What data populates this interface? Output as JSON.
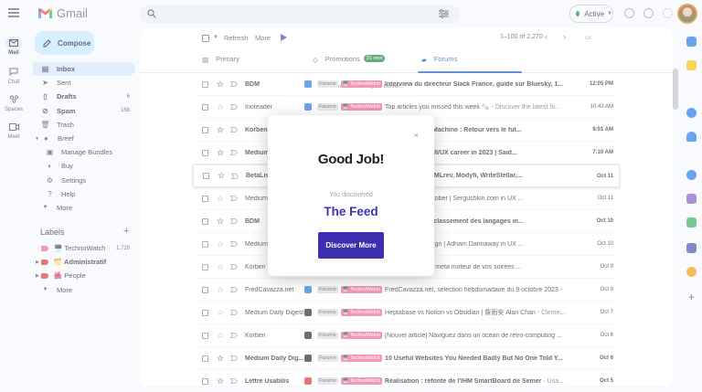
{
  "app": {
    "name": "Gmail"
  },
  "search": {
    "placeholder": ""
  },
  "status": {
    "label": "Active",
    "color": "#188038"
  },
  "rail": [
    {
      "label": "Mail",
      "icon": "mail-icon"
    },
    {
      "label": "Chat",
      "icon": "chat-icon"
    },
    {
      "label": "Spaces",
      "icon": "spaces-icon"
    },
    {
      "label": "Meet",
      "icon": "meet-icon"
    }
  ],
  "compose": {
    "label": "Compose"
  },
  "nav": [
    {
      "label": "Inbox",
      "count": "",
      "icon": "inbox-icon"
    },
    {
      "label": "Sent",
      "count": "",
      "icon": "send-icon"
    },
    {
      "label": "Drafts",
      "count": "6",
      "icon": "draft-icon"
    },
    {
      "label": "Spam",
      "count": "168",
      "icon": "spam-icon"
    },
    {
      "label": "Trash",
      "count": "",
      "icon": "trash-icon"
    },
    {
      "label": "Breef",
      "count": "",
      "icon": "breef-icon"
    },
    {
      "label": "Manage Bundles",
      "count": "",
      "icon": "bundle-icon"
    },
    {
      "label": "Buy",
      "count": "",
      "icon": "buy-icon"
    },
    {
      "label": "Settings",
      "count": "",
      "icon": "gear-icon"
    },
    {
      "label": "Help",
      "count": "",
      "icon": "help-icon"
    },
    {
      "label": "More",
      "count": "",
      "icon": "chevron-down-icon"
    }
  ],
  "labels": {
    "heading": "Labels",
    "items": [
      {
        "label": "🖥️ TechnoWatch",
        "count": "1,729",
        "color": "#e8618c"
      },
      {
        "label": "🗂️ Administratif",
        "count": "",
        "color": "#d93025"
      },
      {
        "label": "🌺 People",
        "count": "",
        "color": "#d93025"
      },
      {
        "label": "More",
        "count": "",
        "color": ""
      }
    ]
  },
  "toolbar": {
    "refresh": "Refresh",
    "more": "More",
    "range": "1–100 of 2,270"
  },
  "tabs": [
    {
      "label": "Primary",
      "badge": ""
    },
    {
      "label": "Promotions",
      "badge": "21 new",
      "sub": "Lev from CodeDesign.ai, Bonnie..."
    },
    {
      "label": "Forums",
      "badge": ""
    }
  ],
  "emails": [
    {
      "sender": "BDM",
      "subject": "Interview du directeur Slack France, guide sur Bluesky, 1...",
      "snippet": "",
      "date": "12:05 PM",
      "unread": true,
      "icon_color": "#1a73e8"
    },
    {
      "sender": "Inoreader",
      "subject": "Top articles you missed this week 🗞️",
      "snippet": " - Discover the latest hi...",
      "date": "10:43 AM",
      "unread": false,
      "icon_color": "#1a73e8"
    },
    {
      "sender": "Korben",
      "subject": "e] Retro Virtual Machine : Retour vers le fut...",
      "snippet": "",
      "date": "9:01 AM",
      "unread": true,
      "icon_color": "#202124"
    },
    {
      "sender": "Medium",
      "subject": "gret- starting a UI/UX career in 2023 | Said...",
      "snippet": "",
      "date": "7:10 AM",
      "unread": true,
      "icon_color": "#202124"
    },
    {
      "sender": "BetaList",
      "subject": "ctgentool.io, HTMLrev, Modyfi, WriteStellar,...",
      "snippet": "",
      "date": "Oct 11",
      "unread": true,
      "icon_color": "#202124"
    },
    {
      "sender": "Medium",
      "subject": "X/UX Tools in October | Sergushkin.com in UX ...",
      "snippet": "",
      "date": "Oct 11",
      "unread": false,
      "icon_color": "#202124"
    },
    {
      "sender": "BDM",
      "subject": "aires du digital, classement des langages in...",
      "snippet": "",
      "date": "Oct 10",
      "unread": true,
      "icon_color": "#1a73e8"
    },
    {
      "sender": "Medium",
      "subject": "efaces for UI design | Adham Dannaway in UX ...",
      "snippet": "",
      "date": "Oct 10",
      "unread": false,
      "icon_color": "#202124"
    },
    {
      "sender": "Korben",
      "subject": "] Movie-web – Le meta moteur de vos soirées ...",
      "snippet": "",
      "date": "Oct 9",
      "unread": false,
      "icon_color": "#202124"
    },
    {
      "sender": "FredCavazza.net",
      "subject": "FredCavazza.net, selection hebdomadaire du 9 octobre 2023",
      "snippet": " -",
      "date": "Oct 9",
      "unread": false,
      "icon_color": "#1a73e8"
    },
    {
      "sender": "Medium Daily Digest",
      "subject": "Heptabase vs Notion vs Obsidian | 詹雨安 Alan Chan",
      "snippet": " - Cleme...",
      "date": "Oct 7",
      "unread": false,
      "icon_color": "#202124"
    },
    {
      "sender": "Korben",
      "subject": "[Nouvel article] Naviguez dans un océan de rétro-computing ...",
      "snippet": "",
      "date": "Oct 6",
      "unread": false,
      "icon_color": "#202124"
    },
    {
      "sender": "Medium Daily Dig...",
      "subject": "10 Useful Websites You Needed Badly But No One Told Y...",
      "snippet": "",
      "date": "Oct 6",
      "unread": true,
      "icon_color": "#202124"
    },
    {
      "sender": "Lettre Usabilis",
      "subject": "Réalisation : refonte de l'IHM SmartBoard de Semer",
      "snippet": " - Usa...",
      "date": "Oct 5",
      "unread": true,
      "icon_color": "#d93025"
    }
  ],
  "tags": {
    "forums": "Forums",
    "technowatch": "🖥️ TechnoWatch"
  },
  "modal": {
    "title": "Good Job!",
    "subtitle": "You discovered",
    "feature": "The Feed",
    "button": "Discover More",
    "close": "×"
  }
}
